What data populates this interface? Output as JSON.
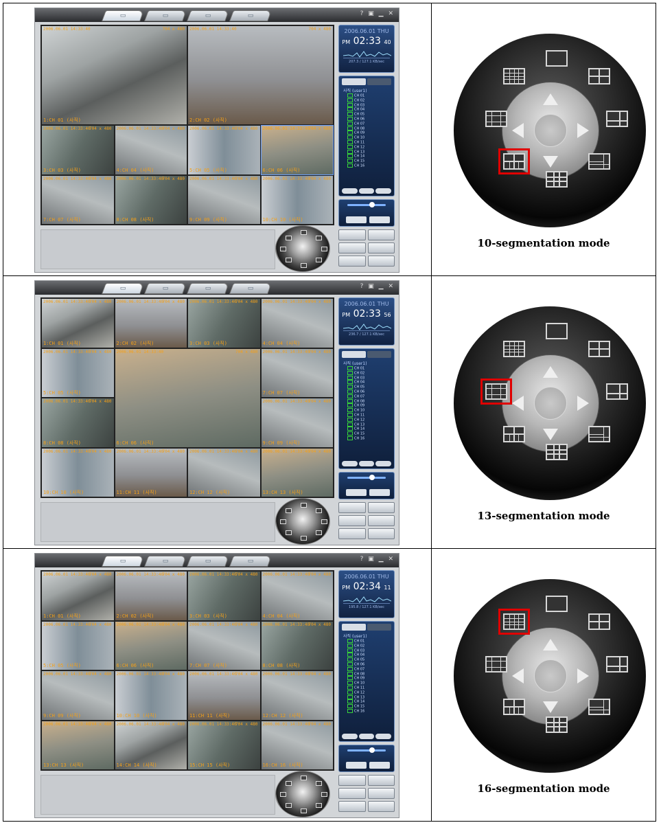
{
  "rows": [
    {
      "caption": "10-segmentation mode",
      "clock": {
        "date": "2006.06.01 THU",
        "ampm": "PM",
        "time": "02:33",
        "seconds": "40",
        "footer": "207.3 / 127.1 KB/sec"
      },
      "selected_layout": "g10",
      "cams": [
        "1:CH 01 (사직)",
        "2:CH 02 (사직)",
        "3:CH 03 (사직)",
        "4:CH 04 (사직)",
        "5:CH 05 (사직)",
        "6:CH 06 (사직)",
        "7:CH 07 (사직)",
        "8:CH 08 (사직)",
        "9:CH 09 (사직)",
        "10:CH 10 (사직)"
      ]
    },
    {
      "caption": "13-segmentation mode",
      "clock": {
        "date": "2006.06.01 THU",
        "ampm": "PM",
        "time": "02:33",
        "seconds": "56",
        "footer": "236.7 / 127.1 KB/sec"
      },
      "selected_layout": "g13",
      "cams": [
        "1:CH 01 (사직)",
        "2:CH 02 (사직)",
        "3:CH 03 (사직)",
        "4:CH 04 (사직)",
        "5:CH 05 (사직)",
        "6:CH 06 (사직)",
        "7:CH 07 (사직)",
        "8:CH 08 (사직)",
        "9:CH 09 (사직)",
        "10:CH 10 (사직)",
        "11:CH 11 (사직)",
        "12:CH 12 (사직)",
        "13:CH 13 (사직)"
      ]
    },
    {
      "caption": "16-segmentation mode",
      "clock": {
        "date": "2006.06.01 THU",
        "ampm": "PM",
        "time": "02:34",
        "seconds": "11",
        "footer": "195.8 / 127.1 KB/sec"
      },
      "selected_layout": "g16",
      "cams": [
        "1:CH 01 (사직)",
        "2:CH 02 (사직)",
        "3:CH 03 (사직)",
        "4:CH 04 (사직)",
        "5:CH 05 (사직)",
        "6:CH 06 (사직)",
        "7:CH 07 (사직)",
        "8:CH 08 (사직)",
        "9:CH 09 (사직)",
        "10:CH 10 (사직)",
        "11:CH 11 (사직)",
        "12:CH 12 (사직)",
        "13:CH 13 (사직)",
        "14:CH 14 (사직)",
        "15:CH 15 (사직)",
        "16:CH 16 (사직)"
      ]
    }
  ],
  "cam_timestamp": "2006.06.01 14:33:40",
  "cam_resolution": "704 x 480",
  "channel_tree": {
    "root": "사직 (user1)",
    "channels": [
      "CH 01",
      "CH 02",
      "CH 03",
      "CH 04",
      "CH 05",
      "CH 06",
      "CH 07",
      "CH 08",
      "CH 09",
      "CH 10",
      "CH 11",
      "CH 12",
      "CH 13",
      "CH 14",
      "CH 15",
      "CH 16"
    ]
  },
  "dial_icons": [
    "g1-top",
    "g4-top-right",
    "g6-right",
    "g8-bottom-right",
    "g9-bottom",
    "g10-bottom-left",
    "g13-left",
    "g16-top-left"
  ],
  "colors": {
    "selection": "#e00000",
    "overlay_text": "#f4a018",
    "panel_blue": "#1f3f70"
  }
}
